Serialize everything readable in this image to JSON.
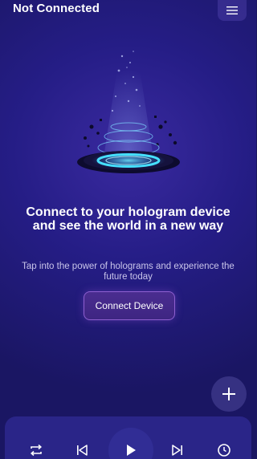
{
  "header": {
    "title": "Not Connected",
    "menu_icon": "hamburger-menu-icon"
  },
  "hero": {
    "illustration": "hologram-projector-icon",
    "headline": "Connect to your hologram device and see the world in a new way",
    "subtext": "Tap into the power of holograms and experience the future today"
  },
  "actions": {
    "connect_label": "Connect Device",
    "fab_icon": "plus-icon"
  },
  "player": {
    "buttons": [
      "repeat-icon",
      "skip-previous-icon",
      "play-icon",
      "skip-next-icon",
      "timer-icon"
    ]
  },
  "colors": {
    "background": "#251d86",
    "player_bar": "#2a2588",
    "accent_cyan": "#3fd6ff",
    "button_border": "#8e5fd0"
  }
}
